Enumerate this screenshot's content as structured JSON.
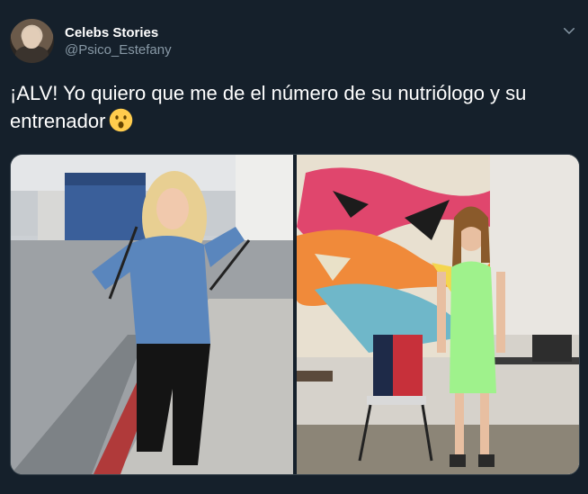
{
  "tweet": {
    "display_name": "Celebs Stories",
    "username": "@Psico_Estefany",
    "text": "¡ALV! Yo quiero que me de el número de su nutriólogo y su entrenador",
    "emoji": "hushed-face-emoji"
  },
  "icons": {
    "menu": "chevron-down-icon"
  },
  "colors": {
    "background": "#15202b",
    "secondary_text": "#8899a6",
    "border": "#38444d"
  },
  "media": {
    "count": 2
  }
}
